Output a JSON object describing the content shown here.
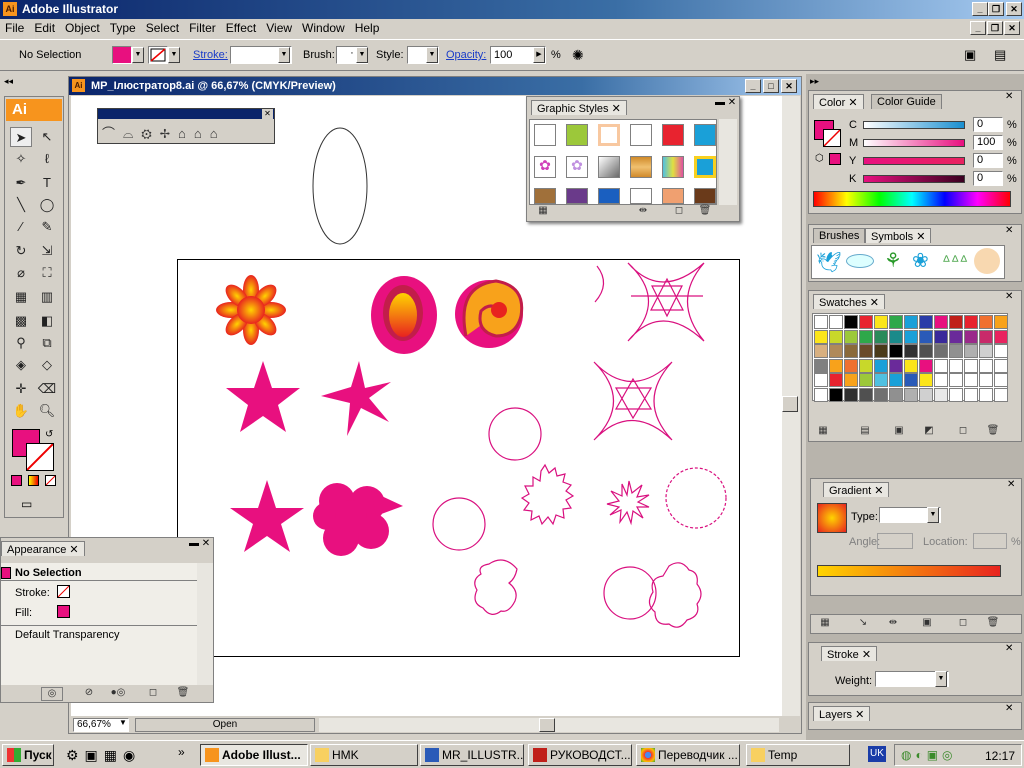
{
  "app": {
    "title": "Adobe Illustrator",
    "icon": "Ai"
  },
  "menu": [
    "File",
    "Edit",
    "Object",
    "Type",
    "Select",
    "Filter",
    "Effect",
    "View",
    "Window",
    "Help"
  ],
  "control_bar": {
    "selection": "No Selection",
    "fill_color": "#e8107f",
    "stroke_label": "Stroke:",
    "brush_label": "Brush:",
    "brush_value": "·",
    "style_label": "Style:",
    "opacity_label": "Opacity:",
    "opacity_value": "100",
    "opacity_unit": "%"
  },
  "document": {
    "title": "MP_Ілюстратор8.ai @ 66,67% (CMYK/Preview)",
    "zoom": "66,67%",
    "status": "Open"
  },
  "graphic_styles": {
    "tab": "Graphic Styles"
  },
  "appearance": {
    "tab": "Appearance",
    "header": "No Selection",
    "stroke_label": "Stroke:",
    "fill_label": "Fill:",
    "transparency": "Default Transparency"
  },
  "color_panel": {
    "tabs": [
      "Color",
      "Color Guide"
    ],
    "channels": [
      {
        "label": "C",
        "value": "0",
        "color": "#1a8fd0"
      },
      {
        "label": "M",
        "value": "100",
        "color": "#e8107f"
      },
      {
        "label": "Y",
        "value": "0",
        "color": "#e8107f"
      },
      {
        "label": "K",
        "value": "0",
        "color": "#e8107f"
      }
    ],
    "unit": "%"
  },
  "brushes_panel": {
    "tabs": [
      "Brushes",
      "Symbols"
    ]
  },
  "swatches_panel": {
    "tab": "Swatches"
  },
  "gradient_panel": {
    "tab": "Gradient",
    "type_label": "Type:",
    "angle_label": "Angle:",
    "location_label": "Location:",
    "unit": "%"
  },
  "stroke_panel": {
    "tab": "Stroke",
    "weight_label": "Weight:"
  },
  "layers_panel": {
    "tab": "Layers"
  },
  "taskbar": {
    "start": "Пуск",
    "tasks": [
      "Adobe Illust...",
      "HMK",
      "MR_ILLUSTR...",
      "РУКОВОДСТ...",
      "Переводчик ...",
      "Temp"
    ],
    "lang": "UK",
    "clock": "12:17"
  }
}
